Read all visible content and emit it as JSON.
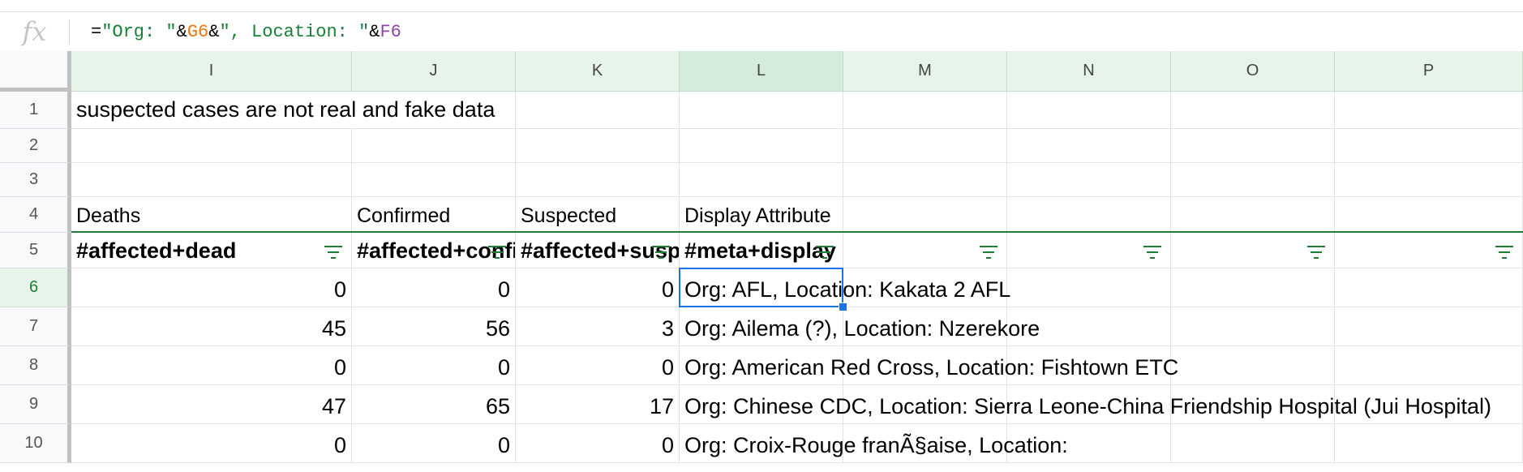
{
  "formula_bar": {
    "fx_label": "fx",
    "formula_tokens": [
      {
        "text": "=",
        "kind": "op"
      },
      {
        "text": "\"Org: \"",
        "kind": "str"
      },
      {
        "text": "&",
        "kind": "op"
      },
      {
        "text": "G6",
        "kind": "g6"
      },
      {
        "text": "&",
        "kind": "op"
      },
      {
        "text": "\", Location: \"",
        "kind": "str"
      },
      {
        "text": "&",
        "kind": "op"
      },
      {
        "text": "F6",
        "kind": "f6"
      }
    ]
  },
  "columns": [
    "I",
    "J",
    "K",
    "L",
    "M",
    "N",
    "O",
    "P"
  ],
  "active_column": "L",
  "rows": [
    "1",
    "2",
    "3",
    "4",
    "5",
    "6",
    "7",
    "8",
    "9",
    "10"
  ],
  "active_row": "6",
  "cells": {
    "I1": "suspected cases are not real and fake data",
    "I4": "Deaths",
    "J4": "Confirmed",
    "K4": "Suspected",
    "L4": "Display Attribute",
    "I5": "#affected+dead",
    "J5": "#affected+confirmed",
    "K5": "#affected+suspected",
    "L5": "#meta+display",
    "I6": "0",
    "J6": "0",
    "K6": "0",
    "L6": "Org: AFL, Location: Kakata 2 AFL",
    "I7": "45",
    "J7": "56",
    "K7": "3",
    "L7": "Org: Ailema (?), Location: Nzerekore",
    "I8": "0",
    "J8": "0",
    "K8": "0",
    "L8": "Org: American Red Cross, Location: Fishtown ETC",
    "I9": "47",
    "J9": "65",
    "K9": "17",
    "L9": "Org: Chinese CDC, Location: Sierra Leone-China Friendship Hospital (Jui Hospital)",
    "I10": "0",
    "J10": "0",
    "K10": "0",
    "L10": "Org: Croix-Rouge franÃ§aise, Location:"
  },
  "filter_icon": "filter-icon",
  "colors": {
    "header_bg": "#e6f4ea",
    "active_header_bg": "#d4ecd9",
    "selection": "#1a73e8",
    "filter_green": "#1e7e34"
  }
}
